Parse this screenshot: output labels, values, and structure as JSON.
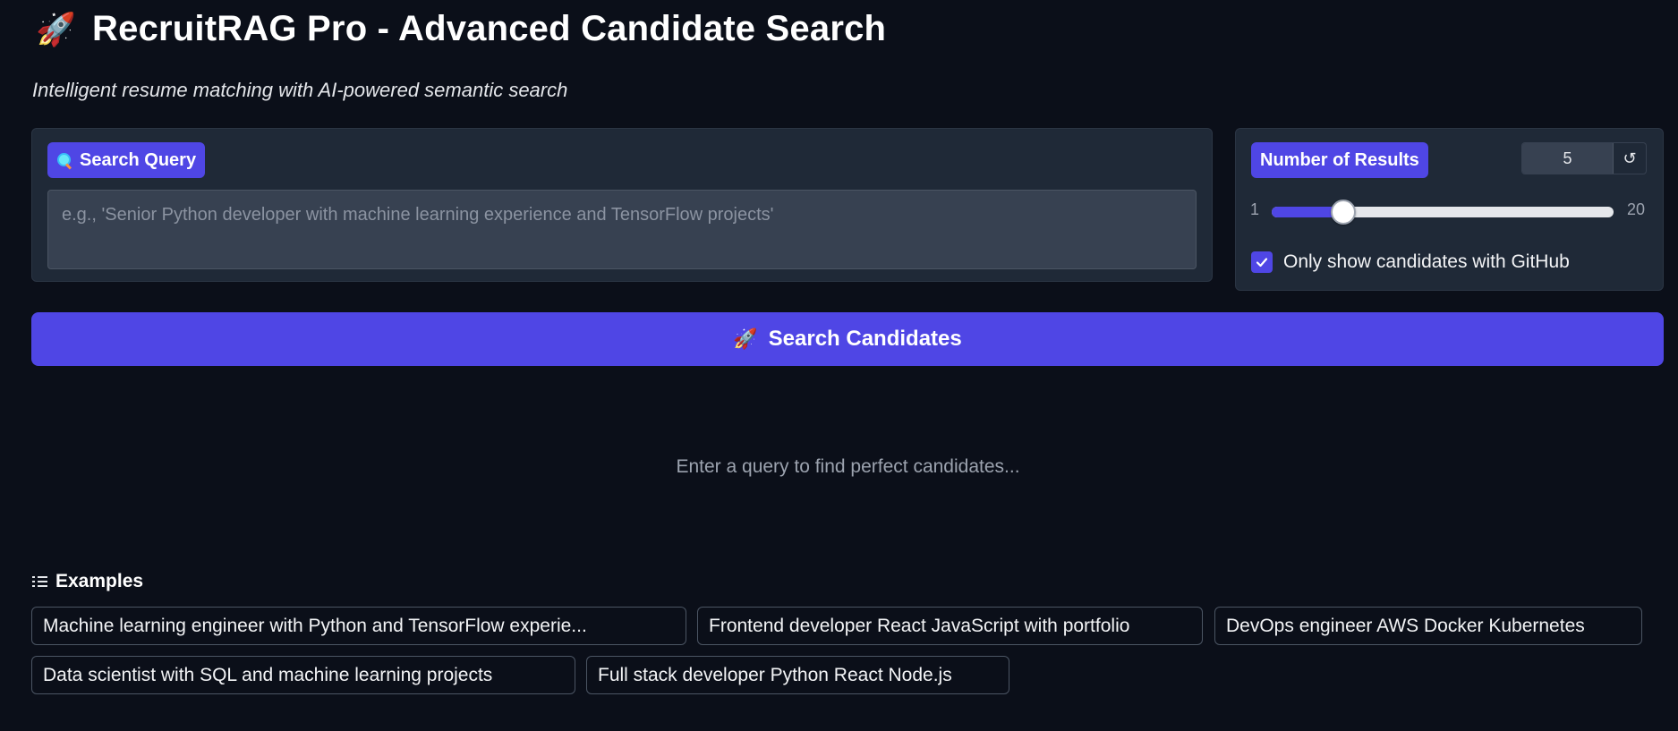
{
  "header": {
    "title": "RecruitRAG Pro - Advanced Candidate Search",
    "subtitle": "Intelligent resume matching with AI-powered semantic search",
    "title_icon": "rocket-icon"
  },
  "query": {
    "label": "Search Query",
    "label_icon": "magnifier-icon",
    "value": "",
    "placeholder": "e.g., 'Senior Python developer with machine learning experience and TensorFlow projects'"
  },
  "results": {
    "label": "Number of Results",
    "value": "5",
    "reset_glyph": "↺",
    "slider_min": "1",
    "slider_max": "20",
    "slider_value": 5
  },
  "github_filter": {
    "label": "Only show candidates with GitHub",
    "checked": true
  },
  "search_button": {
    "label": "Search Candidates",
    "icon": "rocket-icon"
  },
  "empty_state": "Enter a query to find perfect candidates...",
  "examples": {
    "header": "Examples",
    "items": [
      "Machine learning engineer with Python and TensorFlow experie...",
      "Frontend developer React JavaScript with portfolio",
      "DevOps engineer AWS Docker Kubernetes",
      "Data scientist with SQL and machine learning projects",
      "Full stack developer Python React Node.js"
    ]
  },
  "colors": {
    "background": "#0b0f19",
    "panel": "#1f2937",
    "accent": "#4f46e5",
    "input": "#374151"
  }
}
